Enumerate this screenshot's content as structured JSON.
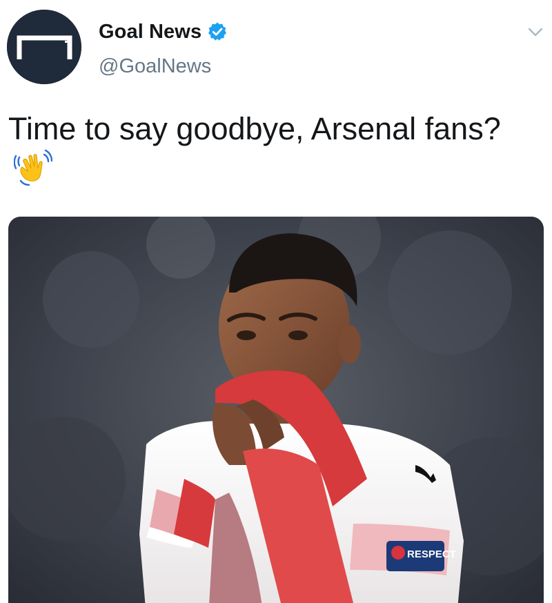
{
  "account": {
    "display_name": "Goal News",
    "handle": "@GoalNews",
    "verified": true,
    "avatar_icon": "goal-logo-icon",
    "verified_icon": "verified-badge-icon"
  },
  "tweet": {
    "text": "Time to say goodbye, Arsenal fans?",
    "emoji": "waving-hand-icon",
    "menu_icon": "chevron-down-icon"
  },
  "media": {
    "type": "photo",
    "sleeve_patch_text": "RESPECT"
  },
  "colors": {
    "verified_blue": "#1da1f2",
    "name_text": "#14171a",
    "handle_text": "#657786",
    "avatar_bg": "#1f2a3a",
    "chevron": "#aab8c2"
  }
}
